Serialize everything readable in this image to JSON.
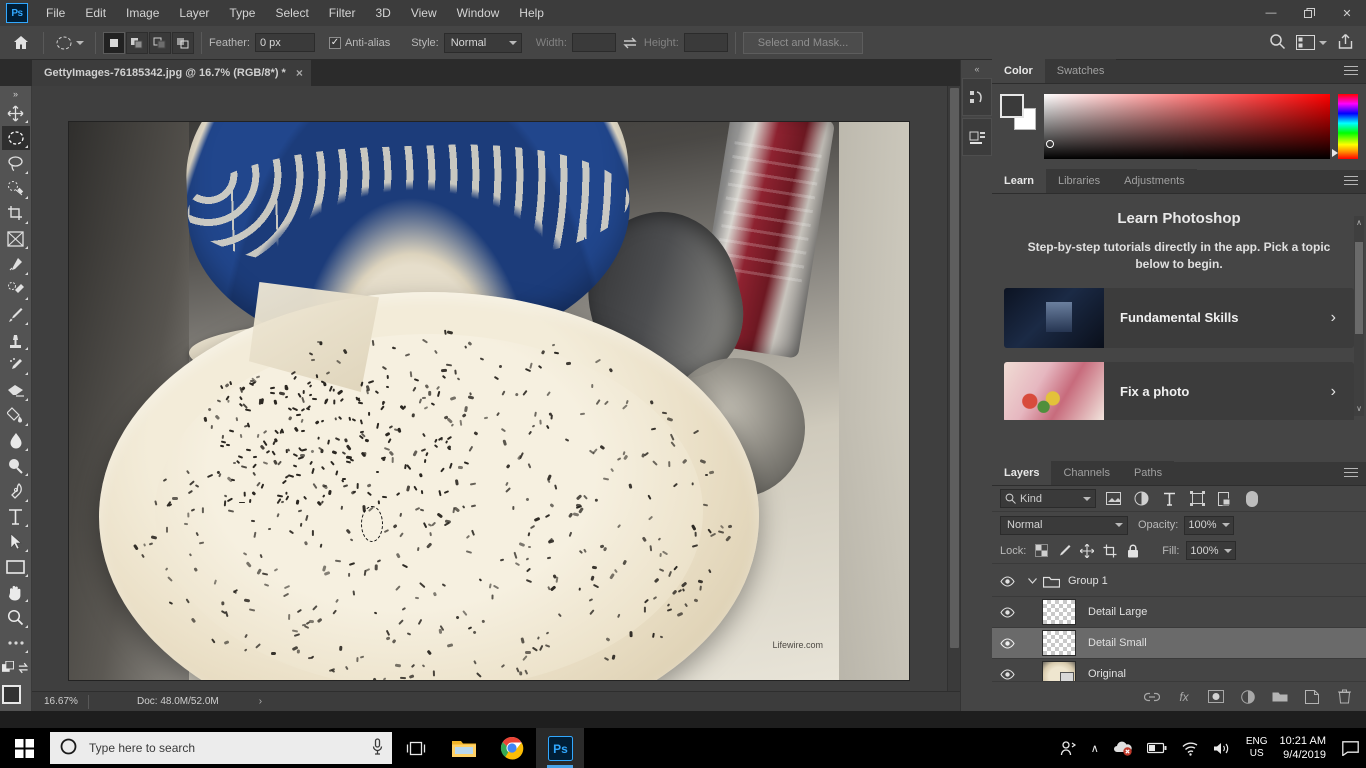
{
  "app": {
    "name": "Adobe Photoshop",
    "logo_text": "Ps"
  },
  "menubar": {
    "items": [
      "File",
      "Edit",
      "Image",
      "Layer",
      "Type",
      "Select",
      "Filter",
      "3D",
      "View",
      "Window",
      "Help"
    ]
  },
  "window_controls": {
    "minimize": "—",
    "restore": "❐",
    "close": "✕"
  },
  "options_bar": {
    "home_icon": "home-icon",
    "tool_preset_icon": "elliptical-marquee-icon",
    "selection_modes": [
      "new-selection",
      "add-to-selection",
      "subtract-from-selection",
      "intersect-with-selection"
    ],
    "active_selection_mode": "new-selection",
    "feather_label": "Feather:",
    "feather_value": "0 px",
    "antialias_label": "Anti-alias",
    "antialias_checked": true,
    "style_label": "Style:",
    "style_value": "Normal",
    "width_label": "Width:",
    "width_value": "",
    "height_label": "Height:",
    "height_value": "",
    "swap_icon": "swap-dimensions-icon",
    "select_and_mask_label": "Select and Mask...",
    "search_icon": "search-icon",
    "workspace_icon": "workspace-icon",
    "share_icon": "share-icon"
  },
  "document_tab": {
    "title": "GettyImages-76185342.jpg @ 16.7% (RGB/8*) *",
    "close_label": "×",
    "expand_label": "»"
  },
  "toolbar": {
    "collapse_label": "»",
    "tools": [
      {
        "name": "move-tool",
        "active": false
      },
      {
        "name": "elliptical-marquee-tool",
        "active": true
      },
      {
        "name": "lasso-tool",
        "active": false
      },
      {
        "name": "object-selection-tool",
        "active": false
      },
      {
        "name": "crop-tool",
        "active": false
      },
      {
        "name": "frame-tool",
        "active": false
      },
      {
        "name": "eyedropper-tool",
        "active": false
      },
      {
        "name": "spot-healing-brush-tool",
        "active": false
      },
      {
        "name": "brush-tool",
        "active": false
      },
      {
        "name": "clone-stamp-tool",
        "active": false
      },
      {
        "name": "history-brush-tool",
        "active": false
      },
      {
        "name": "eraser-tool",
        "active": false
      },
      {
        "name": "gradient-tool",
        "active": false
      },
      {
        "name": "blur-tool",
        "active": false
      },
      {
        "name": "dodge-tool",
        "active": false
      },
      {
        "name": "pen-tool",
        "active": false
      },
      {
        "name": "type-tool",
        "active": false
      },
      {
        "name": "path-selection-tool",
        "active": false
      },
      {
        "name": "rectangle-tool",
        "active": false
      },
      {
        "name": "hand-tool",
        "active": false
      },
      {
        "name": "zoom-tool",
        "active": false
      },
      {
        "name": "more-tools",
        "active": false
      }
    ],
    "foreground_color": "#333333",
    "background_color": "#ffffff"
  },
  "canvas": {
    "image_watermark": "Lifewire.com",
    "selection": "elliptical-marquee-selection",
    "status": {
      "zoom": "16.67%",
      "doc": "Doc: 48.0M/52.0M",
      "arrow": "›"
    }
  },
  "dock_rail": {
    "collapse_label": "«",
    "buttons": [
      "history-panel-icon",
      "properties-panel-icon"
    ]
  },
  "color_panel": {
    "tabs": [
      {
        "label": "Color",
        "active": true
      },
      {
        "label": "Swatches",
        "active": false
      }
    ],
    "menu_icon": "panel-menu-icon",
    "foreground_color": "#3a3a3a",
    "background_color": "#ffffff",
    "ramp_accent": "#ff0000"
  },
  "learn_panel": {
    "tabs": [
      {
        "label": "Learn",
        "active": true
      },
      {
        "label": "Libraries",
        "active": false
      },
      {
        "label": "Adjustments",
        "active": false
      }
    ],
    "menu_icon": "panel-menu-icon",
    "title": "Learn Photoshop",
    "subtitle": "Step-by-step tutorials directly in the app. Pick a topic below to begin.",
    "cards": [
      {
        "label": "Fundamental Skills",
        "arrow": "›"
      },
      {
        "label": "Fix a photo",
        "arrow": "›"
      }
    ],
    "scroll_up": "∧",
    "scroll_down": "∨"
  },
  "layers_panel": {
    "tabs": [
      {
        "label": "Layers",
        "active": true
      },
      {
        "label": "Channels",
        "active": false
      },
      {
        "label": "Paths",
        "active": false
      }
    ],
    "menu_icon": "panel-menu-icon",
    "filter": {
      "kind_label": "Kind",
      "search_icon": "search-icon",
      "chevron": "⌄",
      "filter_icons": [
        "pixel-layers-filter-icon",
        "adjustment-layers-filter-icon",
        "type-layers-filter-icon",
        "shape-layers-filter-icon",
        "smart-object-filter-icon"
      ],
      "toggle": "filter-toggle"
    },
    "blend_mode": "Normal",
    "blend_chevron": "⌄",
    "opacity_label": "Opacity:",
    "opacity_value": "100%",
    "lock_label": "Lock:",
    "lock_icons": [
      "lock-transparent-pixels-icon",
      "lock-image-pixels-icon",
      "lock-position-icon",
      "lock-artboard-nesting-icon",
      "lock-all-icon"
    ],
    "fill_label": "Fill:",
    "fill_value": "100%",
    "layers": [
      {
        "name": "Group 1",
        "type": "group",
        "visible": true,
        "selected": false,
        "expanded": true
      },
      {
        "name": "Detail Large",
        "type": "pixel-empty",
        "visible": true,
        "selected": false
      },
      {
        "name": "Detail Small",
        "type": "pixel-empty",
        "visible": true,
        "selected": true
      },
      {
        "name": "Original",
        "type": "smart-object",
        "visible": true,
        "selected": false
      }
    ],
    "footer_icons": [
      "link-layers-icon",
      "add-layer-style-icon",
      "add-layer-mask-icon",
      "new-adjustment-layer-icon",
      "new-group-icon",
      "new-layer-icon",
      "delete-layer-icon"
    ],
    "footer_fx_label": "fx"
  },
  "taskbar": {
    "start_icon": "windows-start-icon",
    "search_placeholder": "Type here to search",
    "cortana_icon": "cortana-circle-icon",
    "mic_icon": "microphone-icon",
    "taskview_icon": "task-view-icon",
    "pinned": [
      {
        "name": "file-explorer-icon",
        "active": false
      },
      {
        "name": "google-chrome-icon",
        "active": false
      },
      {
        "name": "photoshop-icon",
        "active": true,
        "label": "Ps"
      }
    ],
    "tray": {
      "people_icon": "people-icon",
      "expand_icon": "∧",
      "onedrive_icon": "onedrive-error-icon",
      "battery_icon": "battery-icon",
      "wifi_icon": "wifi-icon",
      "volume_icon": "volume-icon",
      "language_line1": "ENG",
      "language_line2": "US",
      "time": "10:21 AM",
      "date": "9/4/2019",
      "notification_icon": "action-center-icon"
    }
  }
}
